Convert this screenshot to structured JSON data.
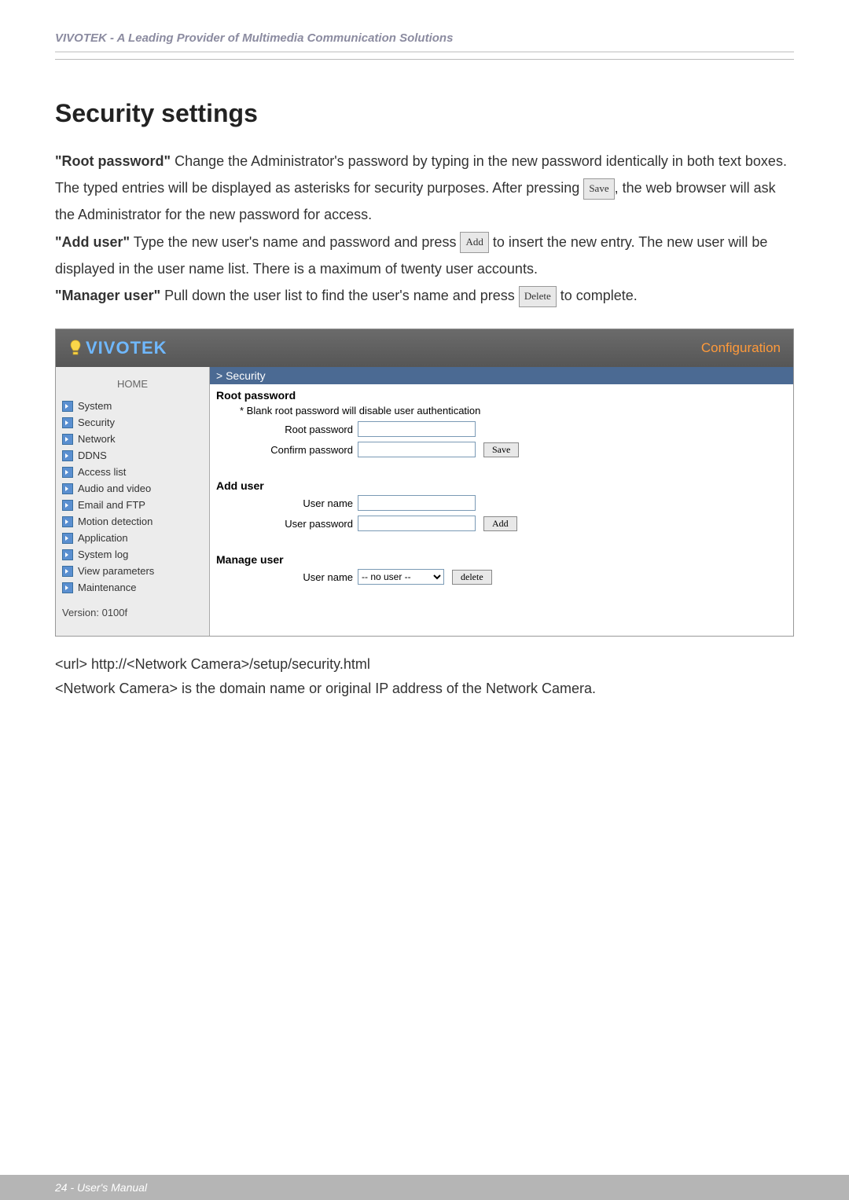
{
  "header": "VIVOTEK - A Leading Provider of Multimedia Communication Solutions",
  "title": "Security settings",
  "para1_lead": "\"Root password\"",
  "para1_a": " Change the Administrator's password by typing in the new password identically in both text boxes. The typed entries will be displayed as asterisks for security purposes. After pressing ",
  "btn_save_inline": "Save",
  "para1_b": ", the web browser will ask the Administrator for the new password for access.",
  "para2_lead": "\"Add user\"",
  "para2_a": " Type the new user's name and password and press ",
  "btn_add_inline": "Add",
  "para2_b": " to insert the new entry. The new user will be displayed in the user name list. There is a maximum of twenty user accounts.",
  "para3_lead": "\"Manager user\"",
  "para3_a": " Pull down the user list to find the user's name and press ",
  "btn_delete_inline": "Delete",
  "para3_b": " to complete.",
  "logo": "VIVOTEK",
  "config_label": "Configuration",
  "nav_home": "HOME",
  "nav_items": [
    "System",
    "Security",
    "Network",
    "DDNS",
    "Access list",
    "Audio and video",
    "Email and FTP",
    "Motion detection",
    "Application",
    "System log",
    "View parameters",
    "Maintenance"
  ],
  "version": "Version: 0100f",
  "crumb": "> Security",
  "root_pw_title": "Root password",
  "root_pw_note": "* Blank root password will disable user authentication",
  "lbl_root_pw": "Root password",
  "lbl_confirm_pw": "Confirm password",
  "btn_save": "Save",
  "add_user_title": "Add user",
  "lbl_user_name": "User name",
  "lbl_user_pw": "User password",
  "btn_add": "Add",
  "manage_title": "Manage user",
  "lbl_mu_user": "User name",
  "sel_no_user": "-- no user --",
  "btn_delete": "delete",
  "url_line": "<url> http://<Network Camera>/setup/security.html",
  "url_note": "<Network Camera> is the domain name or original IP address of the Network Camera.",
  "footer": "24 - User's Manual"
}
